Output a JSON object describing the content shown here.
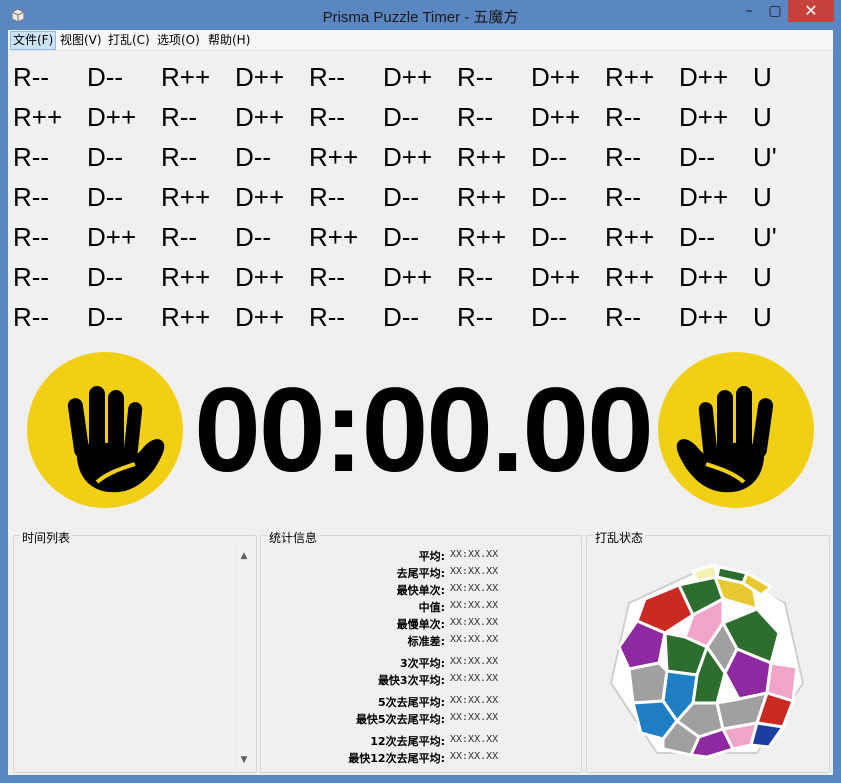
{
  "window": {
    "title": "Prisma Puzzle Timer - 五魔方",
    "controls": {
      "minimize": "–",
      "maximize": "▢",
      "close": "✕"
    }
  },
  "menu": [
    {
      "label": "文件(F)"
    },
    {
      "label": "视图(V)"
    },
    {
      "label": "打乱(C)"
    },
    {
      "label": "选项(O)"
    },
    {
      "label": "帮助(H)"
    }
  ],
  "scramble": {
    "rows": [
      [
        "R--",
        "D--",
        "R++",
        "D++",
        "R--",
        "D++",
        "R--",
        "D++",
        "R++",
        "D++",
        "U"
      ],
      [
        "R++",
        "D++",
        "R--",
        "D++",
        "R--",
        "D--",
        "R--",
        "D++",
        "R--",
        "D++",
        "U"
      ],
      [
        "R--",
        "D--",
        "R--",
        "D--",
        "R++",
        "D++",
        "R++",
        "D--",
        "R--",
        "D--",
        "U'"
      ],
      [
        "R--",
        "D--",
        "R++",
        "D++",
        "R--",
        "D--",
        "R++",
        "D--",
        "R--",
        "D++",
        "U"
      ],
      [
        "R--",
        "D++",
        "R--",
        "D--",
        "R++",
        "D--",
        "R++",
        "D--",
        "R++",
        "D--",
        "U'"
      ],
      [
        "R--",
        "D--",
        "R++",
        "D++",
        "R--",
        "D++",
        "R--",
        "D++",
        "R++",
        "D++",
        "U"
      ],
      [
        "R--",
        "D--",
        "R++",
        "D++",
        "R--",
        "D--",
        "R--",
        "D--",
        "R--",
        "D++",
        "U"
      ]
    ]
  },
  "timer": {
    "display": "00:00.00"
  },
  "hand_color": "#f0cf14",
  "panels": {
    "times": {
      "title": "时间列表",
      "up_arrow": "▲",
      "down_arrow": "▼"
    },
    "stats": {
      "title": "统计信息",
      "groups": [
        [
          {
            "label": "平均:",
            "value": "XX:XX.XX"
          },
          {
            "label": "去尾平均:",
            "value": "XX:XX.XX"
          },
          {
            "label": "最快单次:",
            "value": "XX:XX.XX"
          },
          {
            "label": "中值:",
            "value": "XX:XX.XX"
          },
          {
            "label": "最慢单次:",
            "value": "XX:XX.XX"
          },
          {
            "label": "标准差:",
            "value": "XX:XX.XX"
          }
        ],
        [
          {
            "label": "3次平均:",
            "value": "XX:XX.XX"
          },
          {
            "label": "最快3次平均:",
            "value": "XX:XX.XX"
          }
        ],
        [
          {
            "label": "5次去尾平均:",
            "value": "XX:XX.XX"
          },
          {
            "label": "最快5次去尾平均:",
            "value": "XX:XX.XX"
          }
        ],
        [
          {
            "label": "12次去尾平均:",
            "value": "XX:XX.XX"
          },
          {
            "label": "最快12次去尾平均:",
            "value": "XX:XX.XX"
          }
        ]
      ]
    },
    "scramble_state": {
      "title": "打乱状态"
    }
  }
}
